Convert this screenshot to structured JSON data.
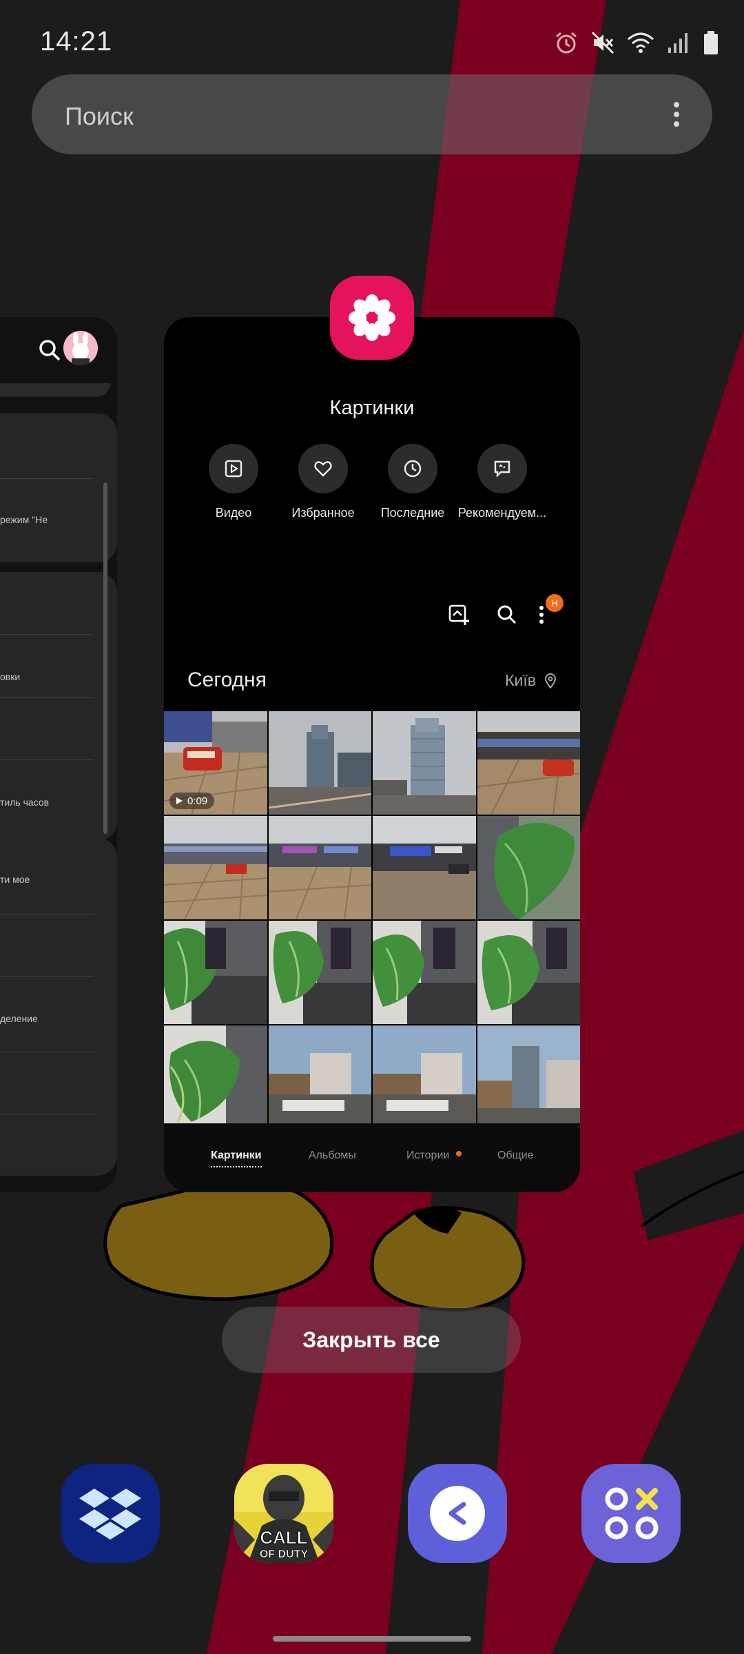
{
  "status_bar": {
    "time": "14:21",
    "icons": [
      "alarm-icon",
      "mute-icon",
      "wifi-icon",
      "signal-icon",
      "battery-icon"
    ]
  },
  "search": {
    "placeholder": "Поиск"
  },
  "left_card": {
    "snippets": [
      "режим \"Не",
      "овки",
      "тиль часов",
      "ти мое",
      "деление"
    ]
  },
  "gallery_card": {
    "app_name": "Картинки",
    "icon_color": "#e5125d",
    "quick_actions": [
      {
        "label": "Видео",
        "icon": "video-icon"
      },
      {
        "label": "Избранное",
        "icon": "heart-icon"
      },
      {
        "label": "Последние",
        "icon": "clock-icon"
      },
      {
        "label": "Рекомендуем...",
        "icon": "suggestions-icon"
      }
    ],
    "toolbar": {
      "badge": "Н"
    },
    "date_header": "Сегодня",
    "location": "Київ",
    "video_duration": "0:09",
    "tabs": [
      {
        "label": "Картинки",
        "active": true
      },
      {
        "label": "Альбомы",
        "active": false
      },
      {
        "label": "Истории",
        "active": false,
        "has_dot": true
      },
      {
        "label": "Общие",
        "active": false
      }
    ]
  },
  "close_all_label": "Закрыть все",
  "dock": {
    "apps": [
      {
        "name": "dropbox",
        "color": "#0d2481"
      },
      {
        "name": "call-of-duty",
        "text": "CALL OF DUTY"
      },
      {
        "name": "samsung-share",
        "color": "#5d60d8"
      },
      {
        "name": "game-launcher",
        "color": "#6c63d9"
      }
    ]
  },
  "colors": {
    "wallpaper_red": "#7a0020",
    "accent_orange": "#f26a1b"
  }
}
